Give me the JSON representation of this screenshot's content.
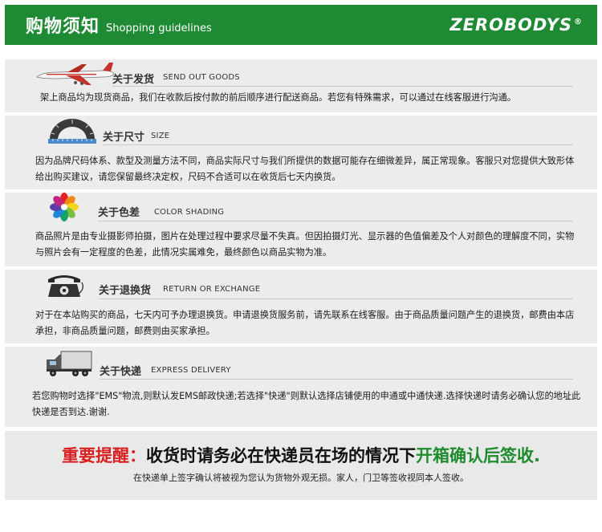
{
  "header": {
    "title_cn": "购物须知",
    "title_en": "Shopping guidelines",
    "brand": "ZEROBODYS",
    "brand_mark": "®",
    "bg_color": "#1f8a34"
  },
  "sections": [
    {
      "icon": "airplane-icon",
      "title_cn": "关于发货",
      "title_en": "SEND OUT GOODS",
      "body": "架上商品均为现货商品，我们在收款后按付款的前后顺序进行配送商品。若您有特殊需求，可以通过在线客服进行沟通。"
    },
    {
      "icon": "protractor-ruler-icon",
      "title_cn": "关于尺寸",
      "title_en": "SIZE",
      "body": "因为品牌尺码体系、款型及测量方法不同，商品实际尺寸与我们所提供的数据可能存在细微差异，属正常现象。客服只对您提供大致形体给出购买建议，请您保留最终决定权，尺码不合适可以在收货后七天内换货。"
    },
    {
      "icon": "color-wheel-icon",
      "title_cn": "关于色差",
      "title_en": "COLOR SHADING",
      "body": "商品照片是由专业摄影师拍摄，图片在处理过程中要求尽量不失真。但因拍摄灯光、显示器的色值偏差及个人对颜色的理解度不同，实物与照片会有一定程度的色差，此情况实属难免，最终颜色以商品实物为准。"
    },
    {
      "icon": "telephone-icon",
      "title_cn": "关于退换货",
      "title_en": "RETURN OR EXCHANGE",
      "body": "对于在本站购买的商品，七天内可予办理退换货。申请退换货服务前，请先联系在线客服。由于商品质量问题产生的退换货，邮费由本店承担，非商品质量问题，邮费则由买家承担。"
    },
    {
      "icon": "truck-icon",
      "title_cn": "关于快递",
      "title_en": "EXPRESS DELIVERY",
      "body": "若您购物时选择\"EMS\"物流,则默认发EMS邮政快递;若选择\"快递\"则默认选择店铺使用的申通或中通快递.选择快递时请务必确认您的地址此快递是否到达.谢谢."
    }
  ],
  "reminder": {
    "label": "重要提醒：",
    "text_black": "收货时请务必在快递员在场的情况下",
    "text_green": "开箱确认后签收.",
    "subtext": "在快递单上签字确认将被视为您认为货物外观无损。家人，门卫等签收视同本人签收。",
    "red_color": "#d92020",
    "green_color": "#1e8c2e"
  }
}
